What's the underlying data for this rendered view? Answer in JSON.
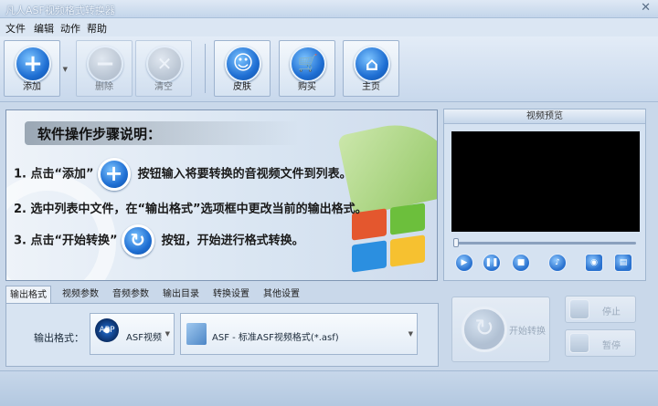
{
  "window": {
    "title": "凡人ASF视频格式转换器",
    "close": "✕"
  },
  "menu": [
    "文件",
    "编辑",
    "动作",
    "帮助"
  ],
  "toolbar": {
    "add": "添加",
    "delete": "删除",
    "clear": "清空",
    "skin": "皮肤",
    "buy": "购买",
    "home": "主页"
  },
  "guide": {
    "heading": "软件操作步骤说明：",
    "step1_pre": "1. 点击“添加”",
    "step1_post": "按钮输入将要转换的音视频文件到列表。",
    "step2": "2. 选中列表中文件，在“输出格式”选项框中更改当前的输出格式。",
    "step3_pre": "3. 点击“开始转换”",
    "step3_post": "按钮，开始进行格式转换。"
  },
  "preview": {
    "title": "视频预览"
  },
  "tabs": [
    "输出格式",
    "视频参数",
    "音频参数",
    "输出目录",
    "转换设置",
    "其他设置"
  ],
  "output": {
    "label": "输出格式：",
    "category": "ASF视频",
    "category_icon_text": "APP",
    "format": "ASF - 标准ASF视频格式(*.asf)"
  },
  "actions": {
    "start": "开始转换",
    "stop": "停止",
    "pause": "暂停"
  }
}
